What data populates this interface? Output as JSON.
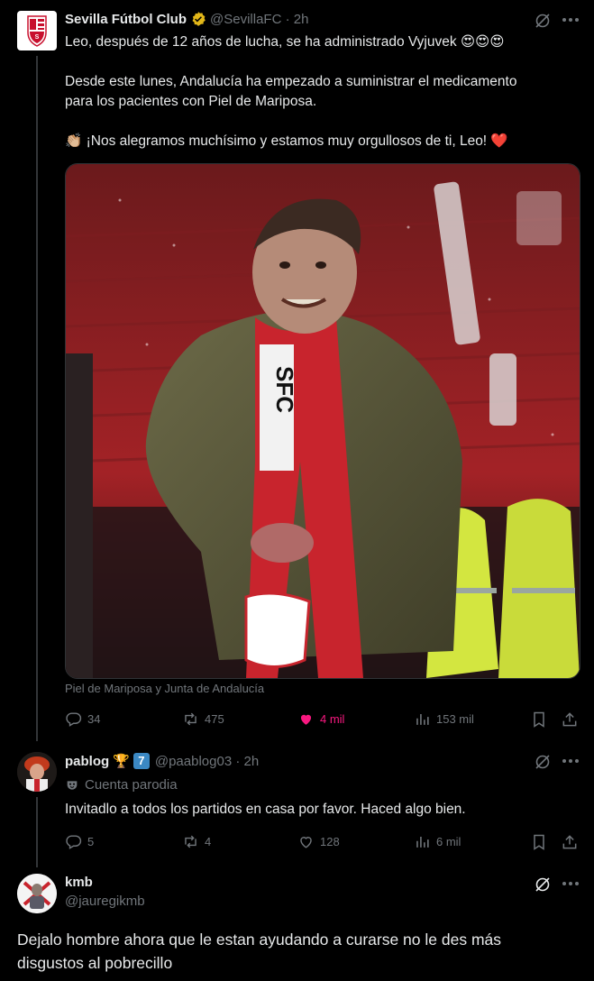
{
  "tweet1": {
    "name": "Sevilla Fútbol Club",
    "handle": "@SevillaFC · 2h",
    "line1": "Leo, después de 12 años de lucha, se ha administrado Vyjuvek 😍😍😍",
    "line2a": "Desde este lunes, Andalucía ha empezado a suministrar el medicamento",
    "line2b": "para los pacientes con Piel de Mariposa.",
    "line3": "👏🏼 ¡Nos alegramos muchísimo y estamos muy orgullosos de ti, Leo! ❤️",
    "caption": "Piel de Mariposa y Junta de Andalucía",
    "replies": "34",
    "reposts": "475",
    "likes": "4 mil",
    "views": "153 mil",
    "like_color": "#f91880"
  },
  "tweet2": {
    "name": "pablog",
    "badge_emoji": "🏆",
    "badge_num": "7",
    "handle": "@paablog03 · 2h",
    "parody_label": "Cuenta parodia",
    "text": "Invitadlo a todos los partidos en casa por favor. Haced algo bien.",
    "replies": "5",
    "reposts": "4",
    "likes": "128",
    "views": "6 mil"
  },
  "tweet3": {
    "name": "kmb",
    "handle": "@jauregikmb",
    "text_a": "Dejalo hombre ahora que le estan ayudando a curarse no le des más",
    "text_b": "disgustos al pobrecillo"
  },
  "colors": {
    "background": "#000000",
    "text": "#e7e9ea",
    "muted": "#71767b",
    "verified_gold": "#e2b719",
    "like_pink": "#f91880"
  }
}
